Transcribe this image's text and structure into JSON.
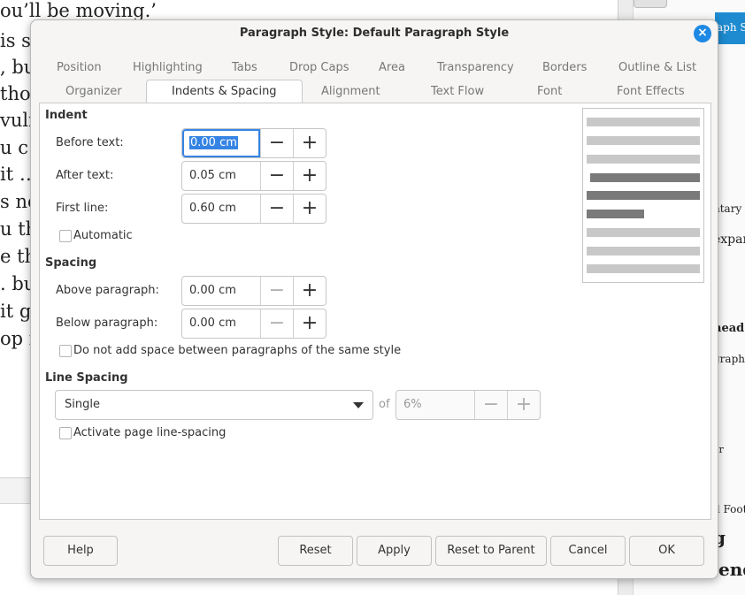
{
  "document": {
    "lines": [
      "ou’ll be moving.’",
      "is  s",
      ", bu",
      "tho",
      "vuln",
      "u  c",
      "it …",
      "s no",
      "u thi",
      "e  th",
      ". bu",
      "it g",
      "op i"
    ],
    "sidebar_texts": [
      "aph S",
      "ntary",
      "expan",
      "head",
      "graph",
      "er",
      "d Foot",
      "g",
      "ppend"
    ]
  },
  "dialog": {
    "title": "Paragraph Style: Default Paragraph Style",
    "close_glyph": "×",
    "tabs_row1": [
      "Position",
      "Highlighting",
      "Tabs",
      "Drop Caps",
      "Area",
      "Transparency",
      "Borders",
      "Outline & List"
    ],
    "tabs_row2": [
      "Organizer",
      "Indents & Spacing",
      "Alignment",
      "Text Flow",
      "Font",
      "Font Effects"
    ],
    "indent": {
      "heading": "Indent",
      "before_label": "Before text:",
      "before_value": "0.00 cm",
      "after_label": "After text:",
      "after_value": "0.05 cm",
      "first_label": "First line:",
      "first_value": "0.60 cm",
      "automatic_label": "Automatic"
    },
    "spacing": {
      "heading": "Spacing",
      "above_label": "Above paragraph:",
      "above_value": "0.00 cm",
      "below_label": "Below paragraph:",
      "below_value": "0.00 cm",
      "no_space_label": "Do not add space between paragraphs of the same style"
    },
    "line_spacing": {
      "heading": "Line Spacing",
      "mode": "Single",
      "of_label": "of",
      "of_value": "6%",
      "page_line_label": "Activate page line-spacing"
    },
    "spin_minus": "−",
    "spin_plus": "+",
    "buttons": {
      "help": "Help",
      "reset": "Reset",
      "apply": "Apply",
      "reset_parent": "Reset to Parent",
      "cancel": "Cancel",
      "ok": "OK"
    },
    "colors": {
      "accent": "#3584e4",
      "close": "#1e88e5",
      "preview_light": "#c8c8c8",
      "preview_dark": "#7a7a7a"
    }
  }
}
